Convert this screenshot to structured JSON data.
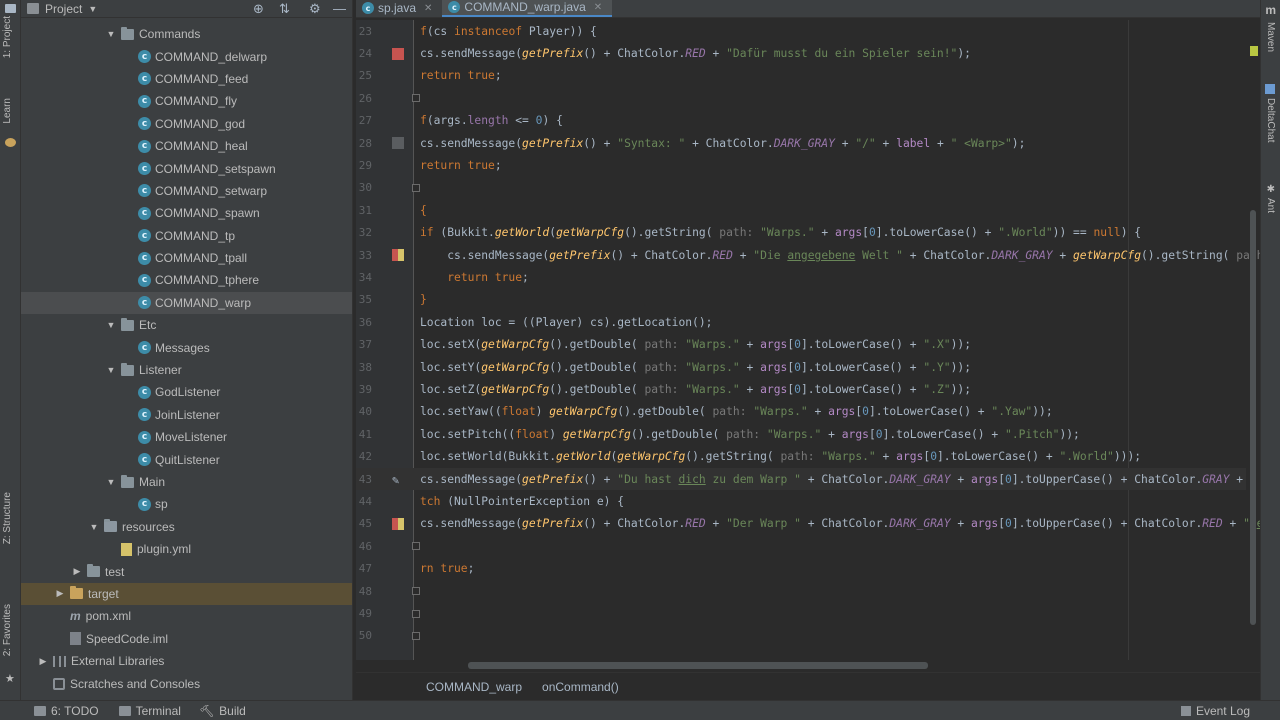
{
  "left_strip": {
    "project_tab": "1: Project",
    "learn_tab": "Learn",
    "structure_tab": "Z: Structure",
    "favorites_tab": "2: Favorites"
  },
  "right_strip": {
    "maven_tab": "Maven",
    "deltachat_tab": "DeltaChat",
    "ant_tab": "Ant"
  },
  "project_panel": {
    "title": "Project",
    "tree": [
      {
        "label": "Commands",
        "type": "folder",
        "depth": 3,
        "expanded": true
      },
      {
        "label": "COMMAND_delwarp",
        "type": "class",
        "depth": 4
      },
      {
        "label": "COMMAND_feed",
        "type": "class",
        "depth": 4
      },
      {
        "label": "COMMAND_fly",
        "type": "class",
        "depth": 4
      },
      {
        "label": "COMMAND_god",
        "type": "class",
        "depth": 4
      },
      {
        "label": "COMMAND_heal",
        "type": "class",
        "depth": 4
      },
      {
        "label": "COMMAND_setspawn",
        "type": "class",
        "depth": 4
      },
      {
        "label": "COMMAND_setwarp",
        "type": "class",
        "depth": 4
      },
      {
        "label": "COMMAND_spawn",
        "type": "class",
        "depth": 4
      },
      {
        "label": "COMMAND_tp",
        "type": "class",
        "depth": 4
      },
      {
        "label": "COMMAND_tpall",
        "type": "class",
        "depth": 4
      },
      {
        "label": "COMMAND_tphere",
        "type": "class",
        "depth": 4
      },
      {
        "label": "COMMAND_warp",
        "type": "class",
        "depth": 4,
        "selected": true
      },
      {
        "label": "Etc",
        "type": "folder",
        "depth": 3,
        "expanded": true
      },
      {
        "label": "Messages",
        "type": "class",
        "depth": 4
      },
      {
        "label": "Listener",
        "type": "folder",
        "depth": 3,
        "expanded": true
      },
      {
        "label": "GodListener",
        "type": "class",
        "depth": 4
      },
      {
        "label": "JoinListener",
        "type": "class",
        "depth": 4
      },
      {
        "label": "MoveListener",
        "type": "class",
        "depth": 4
      },
      {
        "label": "QuitListener",
        "type": "class",
        "depth": 4
      },
      {
        "label": "Main",
        "type": "folder",
        "depth": 3,
        "expanded": true
      },
      {
        "label": "sp",
        "type": "class",
        "depth": 4
      },
      {
        "label": "resources",
        "type": "resfolder",
        "depth": 2,
        "expanded": true
      },
      {
        "label": "plugin.yml",
        "type": "yml",
        "depth": 3
      },
      {
        "label": "test",
        "type": "folder",
        "depth": 1,
        "expanded": false
      },
      {
        "label": "target",
        "type": "orangefolder",
        "depth": 0,
        "expanded": false,
        "target": true
      },
      {
        "label": "pom.xml",
        "type": "maven",
        "depth": 0
      },
      {
        "label": "SpeedCode.iml",
        "type": "iml",
        "depth": 0
      },
      {
        "label": "External Libraries",
        "type": "lib",
        "depth": -1,
        "expanded": false
      },
      {
        "label": "Scratches and Consoles",
        "type": "scratch",
        "depth": -1
      }
    ]
  },
  "editor": {
    "tabs": [
      {
        "label": "sp.java",
        "active": false
      },
      {
        "label": "COMMAND_warp.java",
        "active": true
      }
    ],
    "breadcrumb": [
      "COMMAND_warp",
      "onCommand()"
    ],
    "lines": [
      {
        "n": "23",
        "html": "<span class='k'>f</span>(cs <span class='k'>instanceof</span> Player)) {"
      },
      {
        "n": "24",
        "html": "cs.sendMessage(<span class='m'>getPrefix</span>() + ChatColor.<span class='f'>RED</span> + <span class='s'>\"Dafür musst du ein Spieler sein!\"</span>);",
        "bp": "red"
      },
      {
        "n": "25",
        "html": "<span class='k'>return true</span>;"
      },
      {
        "n": "26",
        "html": ""
      },
      {
        "n": "27",
        "html": "<span class='k'>f</span>(args.<span class='f' style='font-style:normal;color:#9876aa'>length</span> &lt;= <span class='c'>0</span>) {"
      },
      {
        "n": "28",
        "html": "cs.sendMessage(<span class='m'>getPrefix</span>() + <span class='s'>\"Syntax: \"</span> + ChatColor.<span class='f'>DARK_GRAY</span> + <span class='s'>\"/\"</span> + <span class='v'>label</span> + <span class='s'>\" &lt;Warp&gt;\"</span>);",
        "bp": "grey"
      },
      {
        "n": "29",
        "html": "<span class='k'>return true</span>;"
      },
      {
        "n": "30",
        "html": ""
      },
      {
        "n": "31",
        "html": "<span class='k'>{</span>"
      },
      {
        "n": "32",
        "html": "<span class='k'>if</span> (Bukkit.<span class='m'>getWorld</span>(<span class='m'>getWarpCfg</span>().getString( <span class='h'>path:</span> <span class='s'>\"Warps.\"</span> + <span class='v'>args</span>[<span class='c'>0</span>].toLowerCase() + <span class='s'>\".World\"</span>)) == <span class='k'>null</span>) {"
      },
      {
        "n": "33",
        "html": "    cs.sendMessage(<span class='m'>getPrefix</span>() + ChatColor.<span class='f'>RED</span> + <span class='s'>\"Die <u>angegebene</u> Welt \"</span> + ChatColor.<span class='f'>DARK_GRAY</span> + <span class='m'>getWarpCfg</span>().getString( <span class='h'>path:</span> <span class='s'>\"Wa</span>",
        "bp": "multi"
      },
      {
        "n": "34",
        "html": "    <span class='k'>return true</span>;"
      },
      {
        "n": "35",
        "html": "<span class='k'>}</span>"
      },
      {
        "n": "36",
        "html": "Location loc = ((Player) cs).getLocation();"
      },
      {
        "n": "37",
        "html": "loc.setX(<span class='m'>getWarpCfg</span>().getDouble( <span class='h'>path:</span> <span class='s'>\"Warps.\"</span> + <span class='v'>args</span>[<span class='c'>0</span>].toLowerCase() + <span class='s'>\".X\"</span>));"
      },
      {
        "n": "38",
        "html": "loc.setY(<span class='m'>getWarpCfg</span>().getDouble( <span class='h'>path:</span> <span class='s'>\"Warps.\"</span> + <span class='v'>args</span>[<span class='c'>0</span>].toLowerCase() + <span class='s'>\".Y\"</span>));"
      },
      {
        "n": "39",
        "html": "loc.setZ(<span class='m'>getWarpCfg</span>().getDouble( <span class='h'>path:</span> <span class='s'>\"Warps.\"</span> + <span class='v'>args</span>[<span class='c'>0</span>].toLowerCase() + <span class='s'>\".Z\"</span>));"
      },
      {
        "n": "40",
        "html": "loc.setYaw((<span class='k'>float</span>) <span class='m'>getWarpCfg</span>().getDouble( <span class='h'>path:</span> <span class='s'>\"Warps.\"</span> + <span class='v'>args</span>[<span class='c'>0</span>].toLowerCase() + <span class='s'>\".Yaw\"</span>));"
      },
      {
        "n": "41",
        "html": "loc.setPitch((<span class='k'>float</span>) <span class='m'>getWarpCfg</span>().getDouble( <span class='h'>path:</span> <span class='s'>\"Warps.\"</span> + <span class='v'>args</span>[<span class='c'>0</span>].toLowerCase() + <span class='s'>\".Pitch\"</span>));"
      },
      {
        "n": "42",
        "html": "loc.setWorld(Bukkit.<span class='m'>getWorld</span>(<span class='m'>getWarpCfg</span>().getString( <span class='h'>path:</span> <span class='s'>\"Warps.\"</span> + <span class='v'>args</span>[<span class='c'>0</span>].toLowerCase() + <span class='s'>\".World\"</span>)));"
      },
      {
        "n": "43",
        "html": "cs.sendMessage(<span class='m'>getPrefix</span>() + <span class='s'>\"Du hast <u>dich</u> zu dem Warp \"</span> + ChatColor.<span class='f'>DARK_GRAY</span> + <span class='v'>args</span>[<span class='c'>0</span>].toUpperCase() + ChatColor.<span class='f'>GRAY</span> + <span class='s'>\" t\"</span>);",
        "bp": "edit",
        "current": true
      },
      {
        "n": "44",
        "html": "<span class='k'>tch</span> (NullPointerException e) {"
      },
      {
        "n": "45",
        "html": "cs.sendMessage(<span class='m'>getPrefix</span>() + ChatColor.<span class='f'>RED</span> + <span class='s'>\"Der Warp \"</span> + ChatColor.<span class='f'>DARK_GRAY</span> + <span class='v'>args</span>[<span class='c'>0</span>].toUpperCase() + ChatColor.<span class='f'>RED</span> + <span class='s'>\" <u>exist</u></span>",
        "bp": "multi"
      },
      {
        "n": "46",
        "html": ""
      },
      {
        "n": "47",
        "html": "<span class='k'>rn true</span>;"
      },
      {
        "n": "48",
        "html": ""
      },
      {
        "n": "49",
        "html": ""
      },
      {
        "n": "50",
        "html": ""
      }
    ]
  },
  "status_bar": {
    "todo": "6: TODO",
    "terminal": "Terminal",
    "build": "Build",
    "event_log": "Event Log"
  },
  "colors": {
    "background": "#2b2b2b",
    "panel": "#3c3f41",
    "keyword": "#cc7832",
    "string": "#6a8759",
    "method": "#ffc66d",
    "field": "#9876aa",
    "number": "#6897bb"
  }
}
